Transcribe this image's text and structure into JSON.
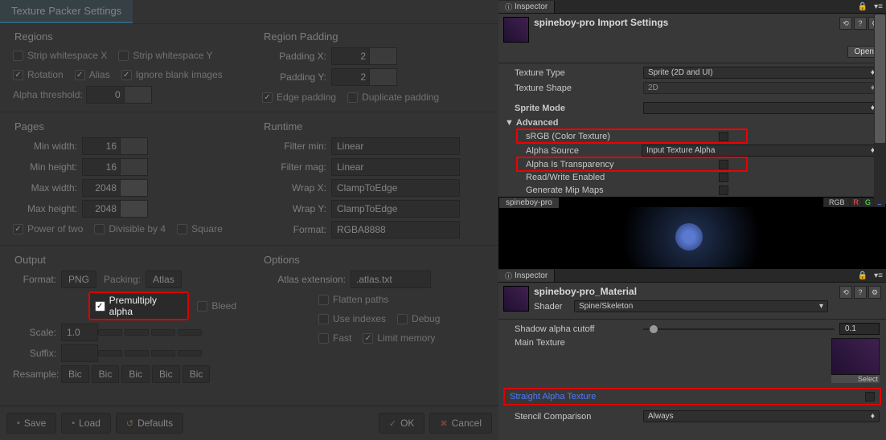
{
  "spine": {
    "title": "Texture Packer Settings",
    "regions": {
      "title": "Regions",
      "strip_x": "Strip whitespace X",
      "strip_y": "Strip whitespace Y",
      "rotation": "Rotation",
      "alias": "Alias",
      "ignore_blank": "Ignore blank images",
      "alpha_threshold_label": "Alpha threshold:",
      "alpha_threshold": "0"
    },
    "padding": {
      "title": "Region Padding",
      "padding_x_label": "Padding X:",
      "padding_x": "2",
      "padding_y_label": "Padding Y:",
      "padding_y": "2",
      "edge": "Edge padding",
      "duplicate": "Duplicate padding"
    },
    "pages": {
      "title": "Pages",
      "min_w_label": "Min width:",
      "min_w": "16",
      "min_h_label": "Min height:",
      "min_h": "16",
      "max_w_label": "Max width:",
      "max_w": "2048",
      "max_h_label": "Max height:",
      "max_h": "2048",
      "pot": "Power of two",
      "div4": "Divisible by 4",
      "square": "Square"
    },
    "runtime": {
      "title": "Runtime",
      "filter_min_label": "Filter min:",
      "filter_min": "Linear",
      "filter_mag_label": "Filter mag:",
      "filter_mag": "Linear",
      "wrap_x_label": "Wrap X:",
      "wrap_x": "ClampToEdge",
      "wrap_y_label": "Wrap Y:",
      "wrap_y": "ClampToEdge",
      "format_label": "Format:",
      "format": "RGBA8888"
    },
    "output": {
      "title": "Output",
      "format_label": "Format:",
      "format": "PNG",
      "packing_label": "Packing:",
      "packing": "Atlas",
      "premultiply": "Premultiply alpha",
      "bleed": "Bleed",
      "scale_label": "Scale:",
      "scale": "1.0",
      "suffix_label": "Suffix:",
      "resample_label": "Resample:",
      "bic": "Bic"
    },
    "options": {
      "title": "Options",
      "atlas_ext_label": "Atlas extension:",
      "atlas_ext": ".atlas.txt",
      "flatten": "Flatten paths",
      "use_indexes": "Use indexes",
      "debug": "Debug",
      "fast": "Fast",
      "limit_mem": "Limit memory"
    },
    "footer": {
      "save": "Save",
      "load": "Load",
      "defaults": "Defaults",
      "ok": "OK",
      "cancel": "Cancel"
    }
  },
  "unity": {
    "inspector": "Inspector",
    "import": {
      "title": "spineboy-pro Import Settings",
      "open": "Open",
      "tex_type_label": "Texture Type",
      "tex_type": "Sprite (2D and UI)",
      "tex_shape_label": "Texture Shape",
      "tex_shape": "2D",
      "sprite_mode_label": "Sprite Mode",
      "advanced": "Advanced",
      "srgb": "sRGB (Color Texture)",
      "alpha_source_label": "Alpha Source",
      "alpha_source": "Input Texture Alpha",
      "alpha_trans": "Alpha Is Transparency",
      "rw": "Read/Write Enabled",
      "mipmaps": "Generate Mip Maps"
    },
    "preview": {
      "name": "spineboy-pro",
      "rgb": "RGB",
      "r": "R",
      "g": "G",
      "b": "B"
    },
    "material": {
      "title": "spineboy-pro_Material",
      "shader_label": "Shader",
      "shader": "Spine/Skeleton",
      "shadow_label": "Shadow alpha cutoff",
      "shadow_val": "0.1",
      "main_tex": "Main Texture",
      "select": "Select",
      "straight": "Straight Alpha Texture",
      "stencil_label": "Stencil Comparison",
      "stencil": "Always"
    }
  }
}
